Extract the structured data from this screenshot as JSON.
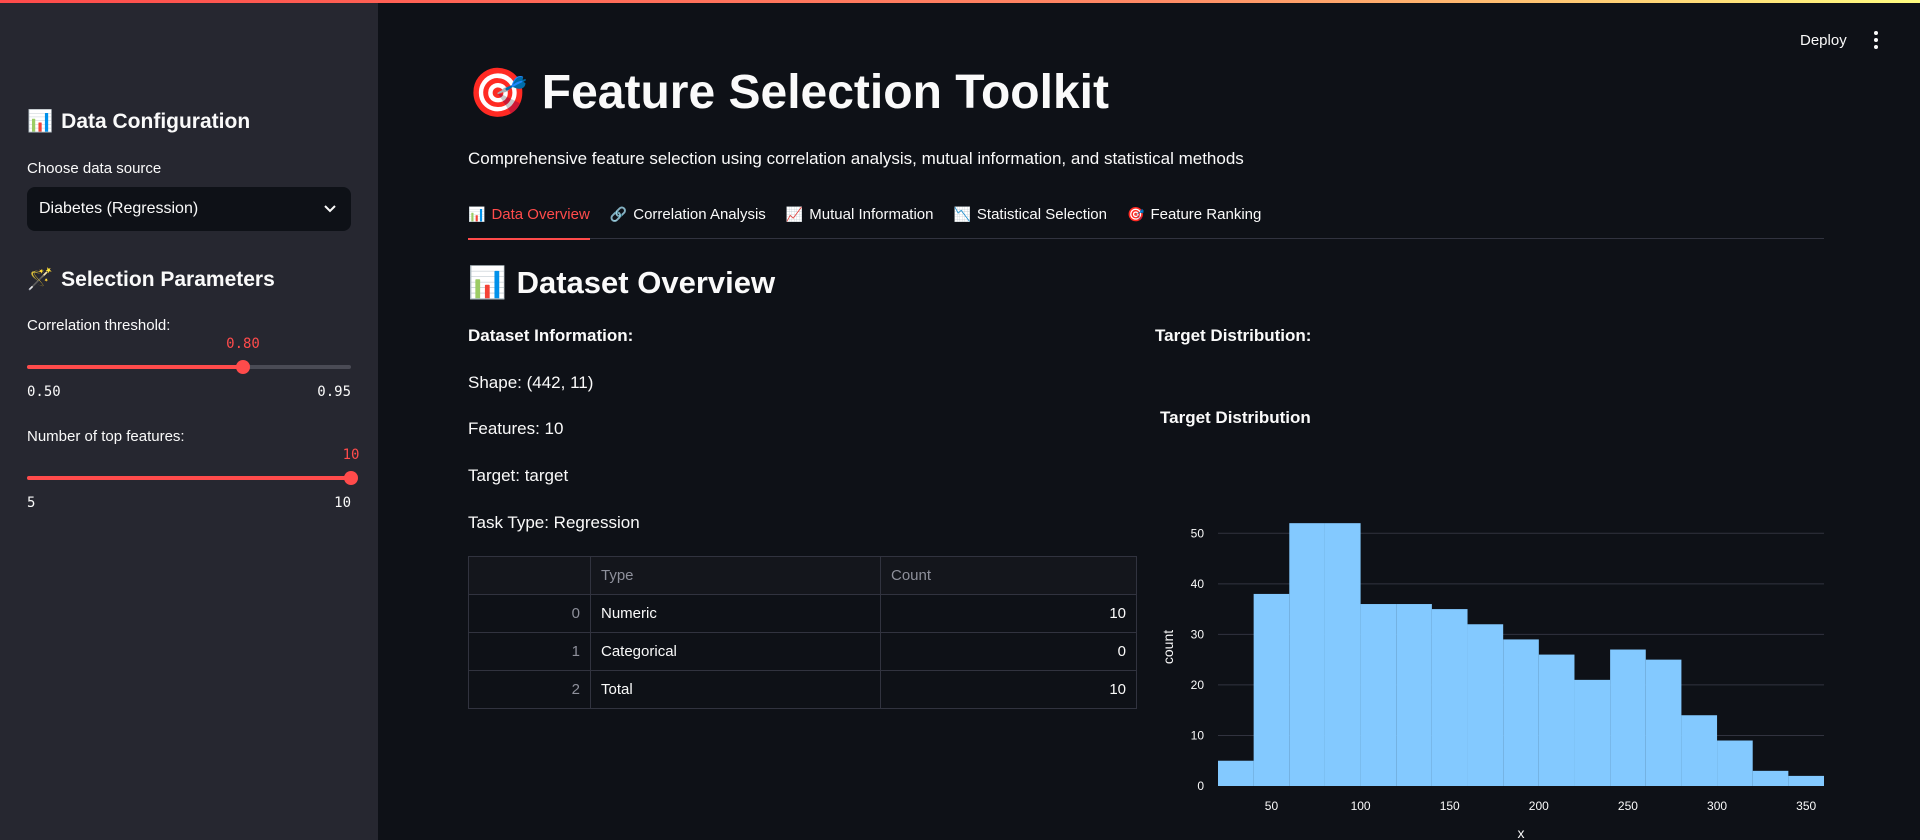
{
  "header": {
    "deploy_label": "Deploy",
    "menu_icon": "kebab-menu-icon"
  },
  "sidebar": {
    "data_config": {
      "icon": "📊",
      "title": "Data Configuration",
      "source_label": "Choose data source",
      "source_value": "Diabetes (Regression)"
    },
    "selection_params": {
      "icon": "🪄",
      "title": "Selection Parameters",
      "corr": {
        "label": "Correlation threshold:",
        "value": "0.80",
        "value_num": 0.8,
        "min": "0.50",
        "max": "0.95",
        "min_num": 0.5,
        "max_num": 0.95
      },
      "topk": {
        "label": "Number of top features:",
        "value": "10",
        "value_num": 10,
        "min": "5",
        "max": "10",
        "min_num": 5,
        "max_num": 10
      }
    }
  },
  "main": {
    "title_icon": "🎯",
    "title": "Feature Selection Toolkit",
    "subtitle": "Comprehensive feature selection using correlation analysis, mutual information, and statistical methods",
    "tabs": [
      {
        "icon": "📊",
        "label": "Data Overview",
        "active": true
      },
      {
        "icon": "🔗",
        "label": "Correlation Analysis",
        "active": false
      },
      {
        "icon": "📈",
        "label": "Mutual Information",
        "active": false
      },
      {
        "icon": "📉",
        "label": "Statistical Selection",
        "active": false
      },
      {
        "icon": "🎯",
        "label": "Feature Ranking",
        "active": false
      }
    ],
    "section_icon": "📊",
    "section_title": "Dataset Overview",
    "info": {
      "heading": "Dataset Information:",
      "shape": "Shape: (442, 11)",
      "features": "Features: 10",
      "target": "Target: target",
      "task": "Task Type: Regression"
    },
    "table": {
      "columns": [
        "",
        "Type",
        "Count"
      ],
      "rows": [
        [
          "0",
          "Numeric",
          "10"
        ],
        [
          "1",
          "Categorical",
          "0"
        ],
        [
          "2",
          "Total",
          "10"
        ]
      ]
    },
    "target_heading": "Target Distribution:"
  },
  "chart_data": {
    "type": "bar",
    "title": "Target Distribution",
    "xlabel": "x",
    "ylabel": "count",
    "bin_width": 20,
    "bin_starts": [
      20,
      40,
      60,
      80,
      100,
      120,
      140,
      160,
      180,
      200,
      220,
      240,
      260,
      280,
      300,
      320,
      340
    ],
    "values": [
      5,
      38,
      52,
      52,
      36,
      36,
      35,
      32,
      29,
      26,
      21,
      27,
      25,
      14,
      9,
      3,
      2
    ],
    "xlim": [
      20,
      360
    ],
    "ylim": [
      0,
      55
    ],
    "xticks": [
      50,
      100,
      150,
      200,
      250,
      300,
      350
    ],
    "yticks": [
      0,
      10,
      20,
      30,
      40,
      50
    ],
    "color": "#83c9ff",
    "grid": true
  }
}
